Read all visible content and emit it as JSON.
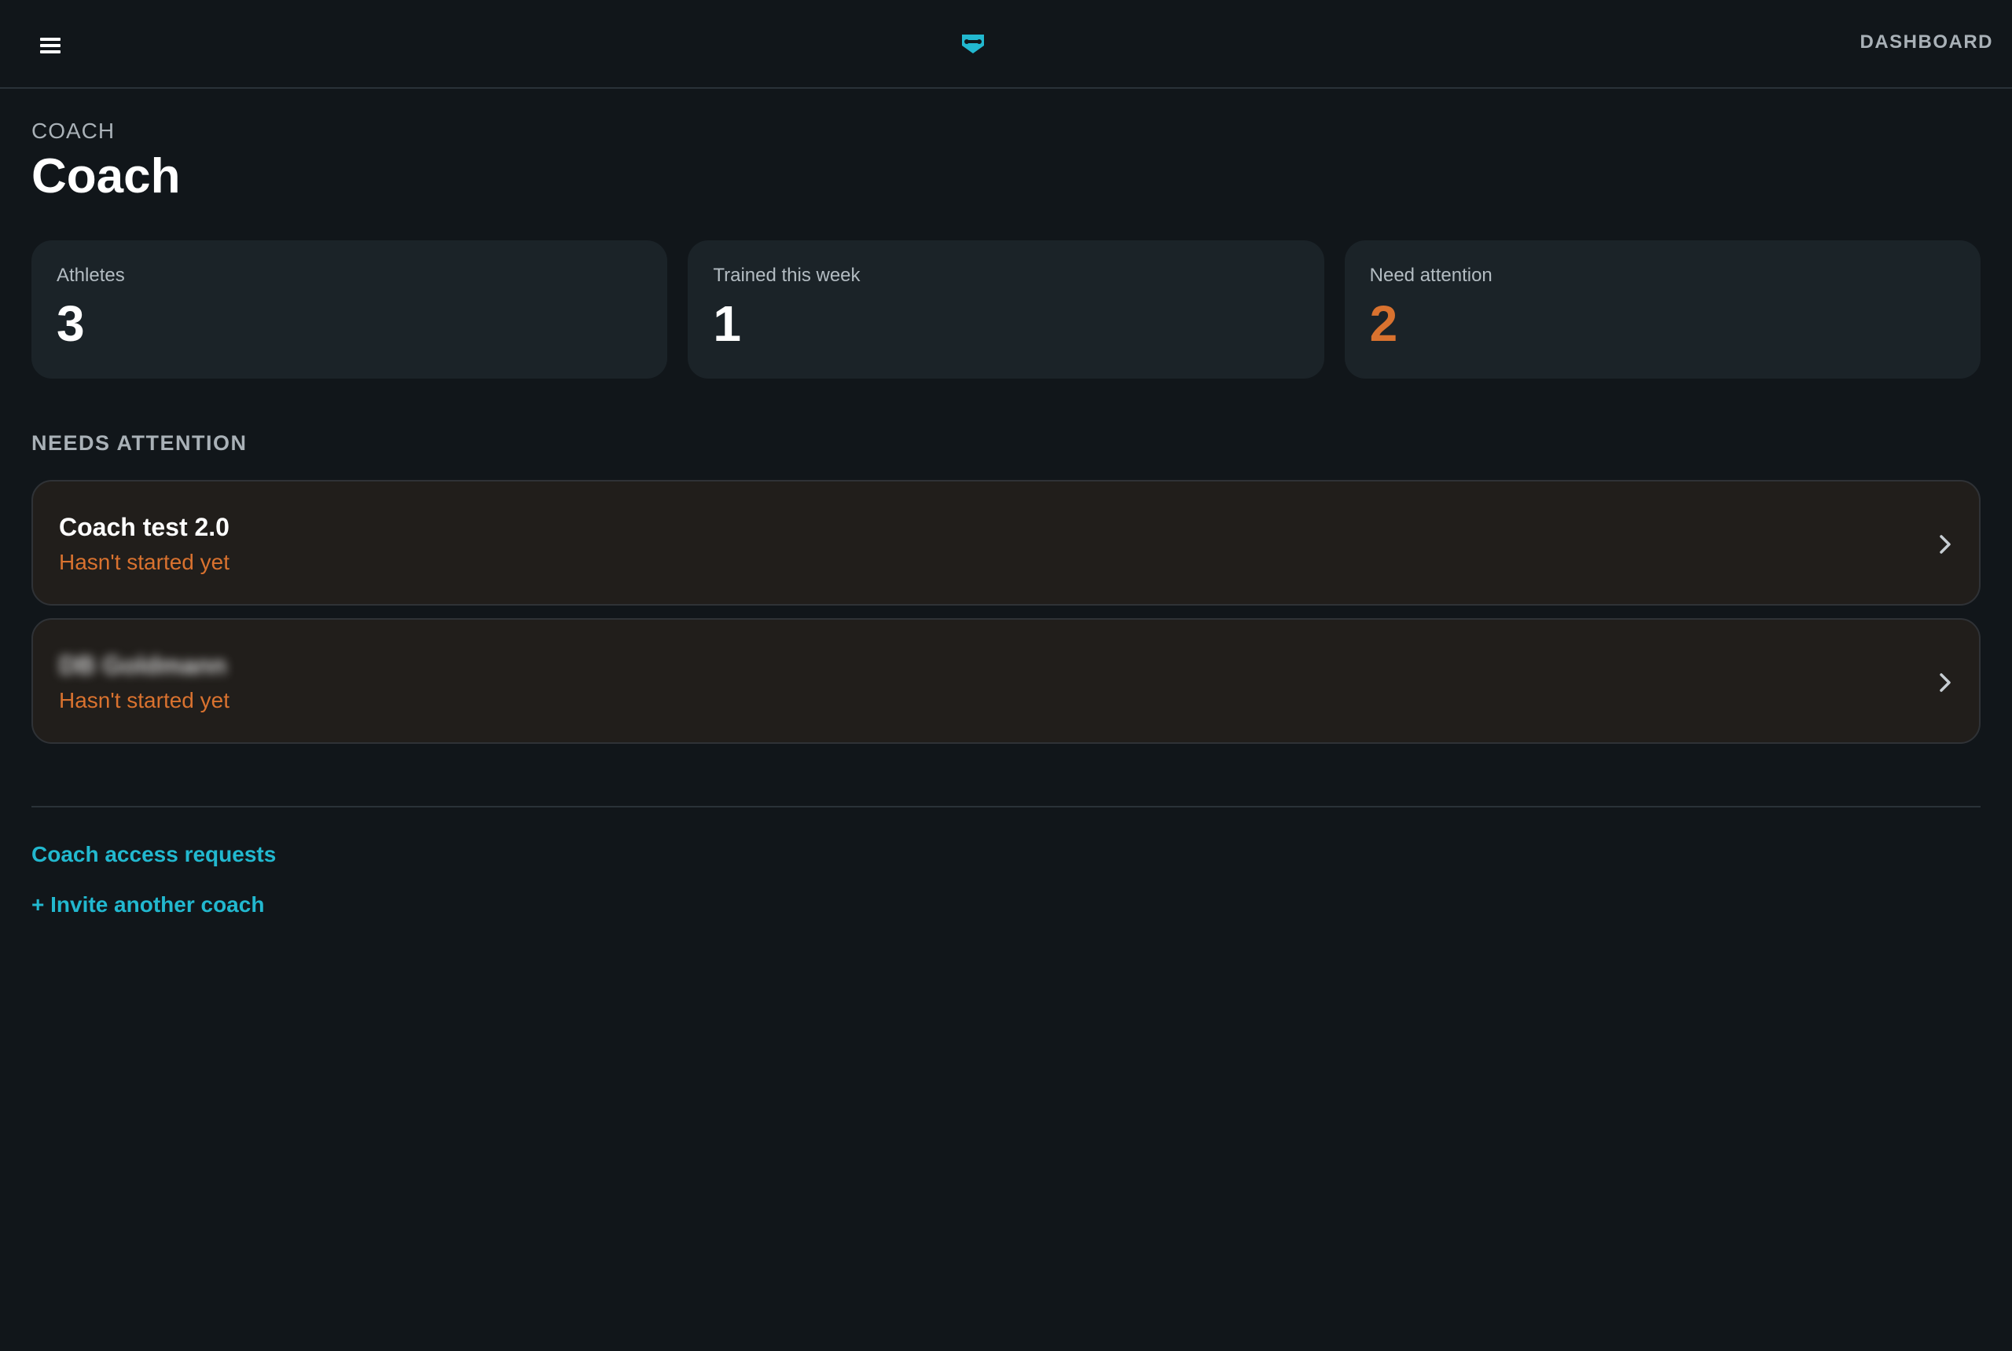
{
  "header": {
    "menu_icon": "hamburger-menu-icon",
    "logo_icon": "brand-logo-icon",
    "logo_color": "#22b8cf",
    "nav_label": "DASHBOARD"
  },
  "page": {
    "eyebrow": "COACH",
    "title": "Coach"
  },
  "stats": [
    {
      "label": "Athletes",
      "value": "3"
    },
    {
      "label": "Trained this week",
      "value": "1"
    },
    {
      "label": "Need attention",
      "value": "2",
      "accent": "#d9722f"
    }
  ],
  "needs_attention": {
    "title": "NEEDS ATTENTION",
    "items": [
      {
        "name": "Coach test 2.0",
        "status": "Hasn't started yet",
        "chevron_icon": "chevron-right-icon"
      },
      {
        "name": "DB Goldmann",
        "status": "Hasn't started yet",
        "chevron_icon": "chevron-right-icon",
        "blurred": true
      }
    ]
  },
  "footer_links": {
    "access_requests": "Coach access requests",
    "invite": "+ Invite another coach"
  },
  "colors": {
    "background": "#11161a",
    "card": "#1b2328",
    "attention_card": "#211e1b",
    "accent_orange": "#d9722f",
    "accent_cyan": "#22b8cf"
  }
}
